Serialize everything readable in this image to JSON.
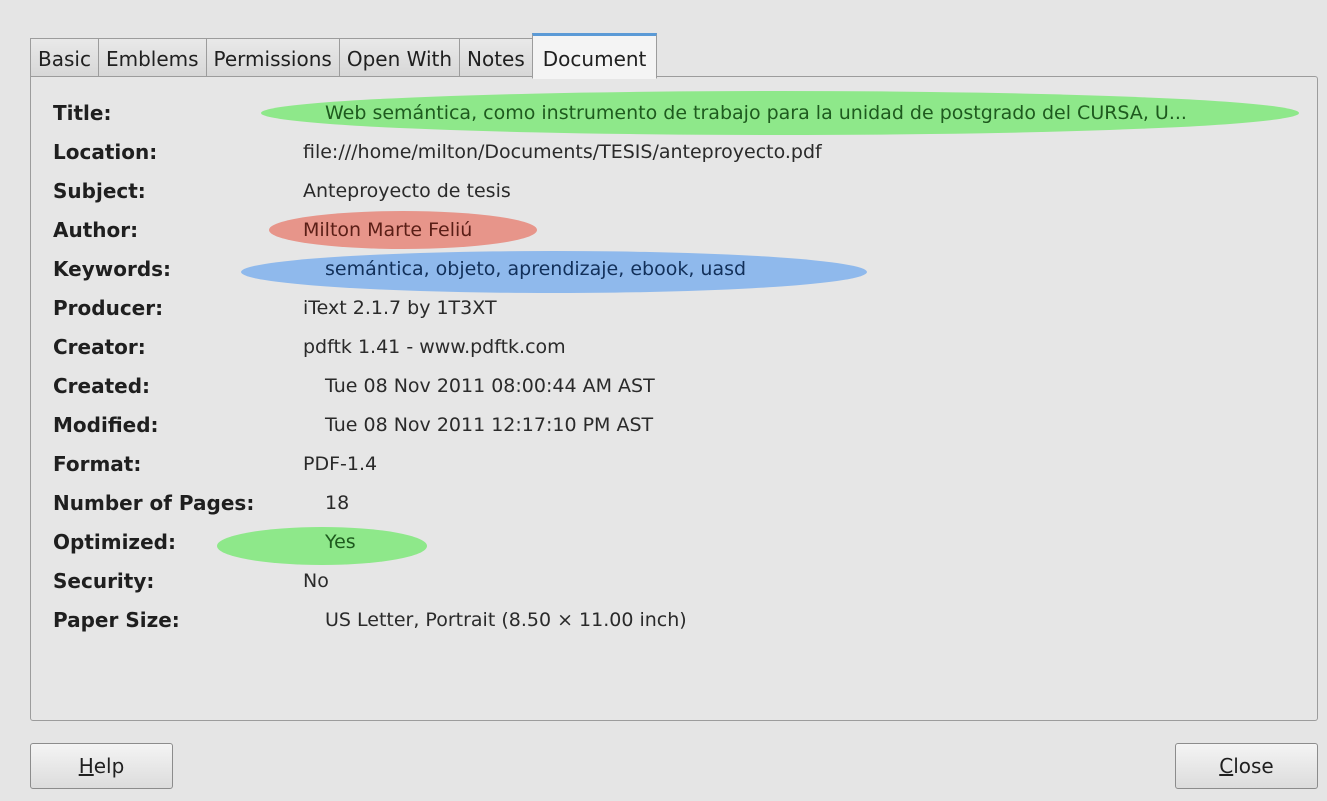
{
  "tabs": [
    {
      "label": "Basic"
    },
    {
      "label": "Emblems"
    },
    {
      "label": "Permissions"
    },
    {
      "label": "Open With"
    },
    {
      "label": "Notes"
    },
    {
      "label": "Document"
    }
  ],
  "active_tab": "Document",
  "properties": [
    {
      "label": "Title:",
      "value": "Web semántica, como instrumento de trabajo para la unidad de postgrado del CURSA, U...",
      "highlight": "#8ee88a"
    },
    {
      "label": "Location:",
      "value": "file:///home/milton/Documents/TESIS/anteproyecto.pdf"
    },
    {
      "label": "Subject:",
      "value": "Anteproyecto de tesis"
    },
    {
      "label": "Author:",
      "value": "Milton Marte Feliú",
      "highlight": "#e7958a"
    },
    {
      "label": "Keywords:",
      "value": "semántica, objeto, aprendizaje, ebook, uasd",
      "highlight": "#8fb9ec"
    },
    {
      "label": "Producer:",
      "value": "iText 2.1.7 by 1T3XT"
    },
    {
      "label": "Creator:",
      "value": "pdftk 1.41 - www.pdftk.com"
    },
    {
      "label": "Created:",
      "value": "Tue 08 Nov 2011 08:00:44 AM AST"
    },
    {
      "label": "Modified:",
      "value": "Tue 08 Nov 2011 12:17:10 PM AST"
    },
    {
      "label": "Format:",
      "value": "PDF-1.4"
    },
    {
      "label": "Number of Pages:",
      "value": "18"
    },
    {
      "label": "Optimized:",
      "value": "Yes",
      "highlight": "#8ee88a"
    },
    {
      "label": "Security:",
      "value": "No"
    },
    {
      "label": "Paper Size:",
      "value": "US Letter, Portrait (8.50 × 11.00 inch)"
    }
  ],
  "buttons": {
    "help_mnemonic": "H",
    "help_rest": "elp",
    "close_mnemonic": "C",
    "close_rest": "lose"
  }
}
